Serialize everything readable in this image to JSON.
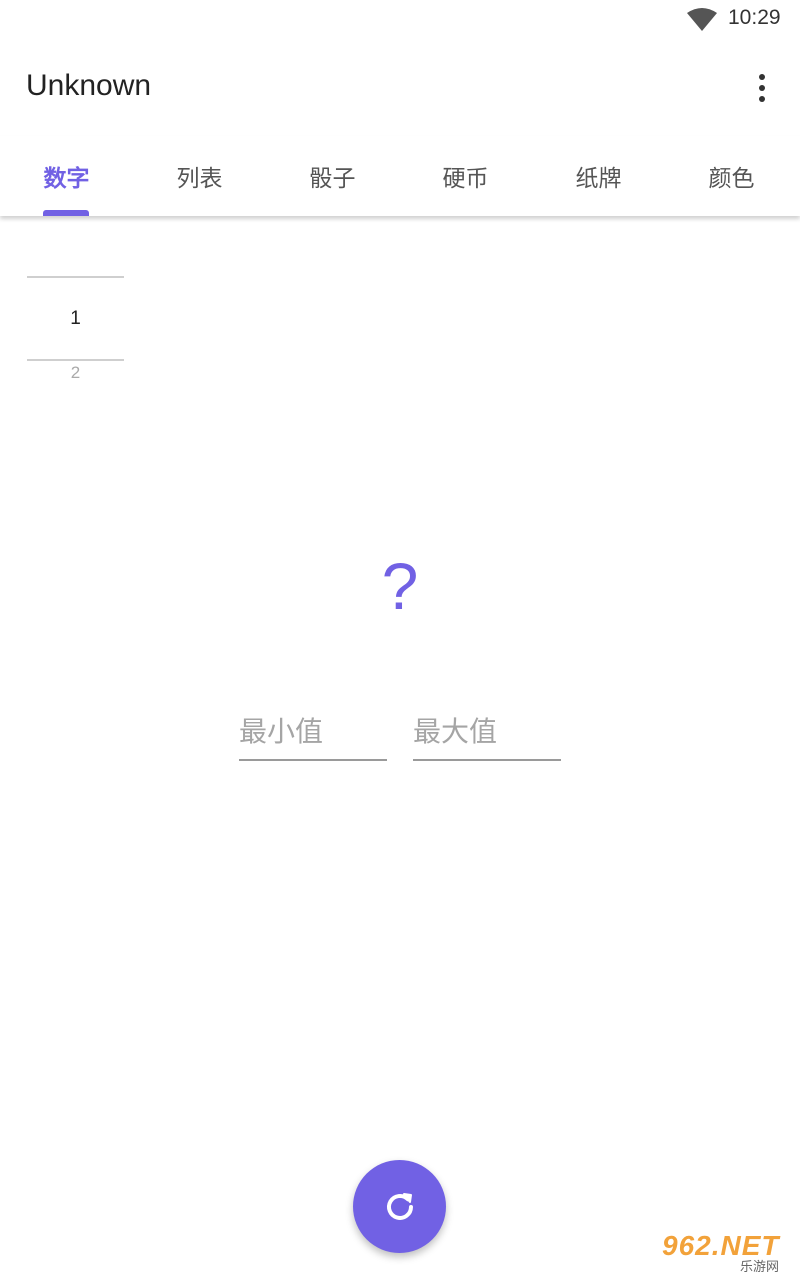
{
  "status_bar": {
    "time": "10:29",
    "wifi_icon": "wifi-icon"
  },
  "app_bar": {
    "title": "Unknown",
    "overflow_icon": "more-vert-icon"
  },
  "tabs": [
    {
      "label": "数字",
      "active": true
    },
    {
      "label": "列表",
      "active": false
    },
    {
      "label": "骰子",
      "active": false
    },
    {
      "label": "硬币",
      "active": false
    },
    {
      "label": "纸牌",
      "active": false
    },
    {
      "label": "颜色",
      "active": false
    }
  ],
  "picker": {
    "selected": "1",
    "next": "2"
  },
  "result": {
    "value": "?"
  },
  "inputs": {
    "min": {
      "placeholder": "最小值",
      "value": ""
    },
    "max": {
      "placeholder": "最大值",
      "value": ""
    }
  },
  "fab": {
    "icon": "refresh-icon"
  },
  "watermark": {
    "logo_text": "962.NET",
    "sub_text": "乐游网"
  },
  "colors": {
    "accent": "#7161e4",
    "text": "#212121",
    "muted": "#a5a5a5"
  }
}
